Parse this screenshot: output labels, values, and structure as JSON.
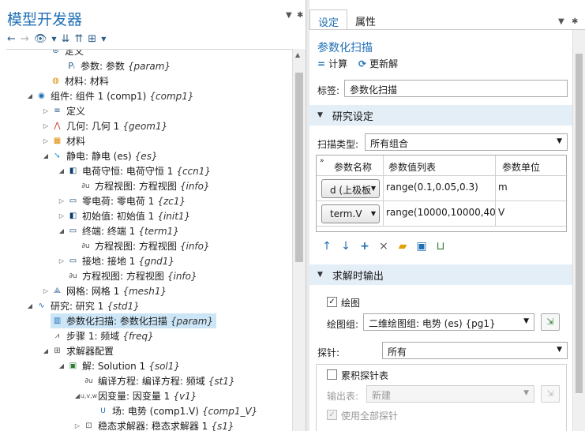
{
  "left_panel": {
    "title": "模型开发器",
    "tree": [
      {
        "label": "定义",
        "tag": ""
      },
      {
        "label": "参数: 参数",
        "tag": "{param}"
      },
      {
        "label": "材料: 材料",
        "tag": ""
      },
      {
        "label": "组件: 组件 1 (comp1)",
        "tag": "{comp1}"
      },
      {
        "label": "定义",
        "tag": ""
      },
      {
        "label": "几何: 几何 1",
        "tag": "{geom1}"
      },
      {
        "label": "材料",
        "tag": ""
      },
      {
        "label": "静电: 静电 (es)",
        "tag": "{es}"
      },
      {
        "label": "电荷守恒: 电荷守恒 1",
        "tag": "{ccn1}"
      },
      {
        "label": "方程视图: 方程视图",
        "tag": "{info}"
      },
      {
        "label": "零电荷: 零电荷 1",
        "tag": "{zc1}"
      },
      {
        "label": "初始值: 初始值 1",
        "tag": "{init1}"
      },
      {
        "label": "终端: 终端 1",
        "tag": "{term1}"
      },
      {
        "label": "方程视图: 方程视图",
        "tag": "{info}"
      },
      {
        "label": "接地: 接地 1",
        "tag": "{gnd1}"
      },
      {
        "label": "方程视图: 方程视图",
        "tag": "{info}"
      },
      {
        "label": "网格: 网格 1",
        "tag": "{mesh1}"
      },
      {
        "label": "研究: 研究 1",
        "tag": "{std1}"
      },
      {
        "label": "参数化扫描: 参数化扫描",
        "tag": "{param}"
      },
      {
        "label": "步骤 1: 频域",
        "tag": "{freq}"
      },
      {
        "label": "求解器配置",
        "tag": ""
      },
      {
        "label": "解: Solution 1",
        "tag": "{sol1}"
      },
      {
        "label": "编译方程: 编译方程: 频域",
        "tag": "{st1}"
      },
      {
        "label": "因变量: 因变量 1",
        "tag": "{v1}"
      },
      {
        "label": "场: 电势 (comp1.V)",
        "tag": "{comp1_V}"
      },
      {
        "label": "稳态求解器: 稳态求解器 1",
        "tag": "{s1}"
      }
    ]
  },
  "right_panel": {
    "tabs": [
      "设定",
      "属性"
    ],
    "title": "参数化扫描",
    "actions": {
      "compute": "计算",
      "update": "更新解"
    },
    "label_field": {
      "label": "标签:",
      "value": "参数化扫描"
    },
    "study_settings": {
      "header": "研究设定",
      "sweep_type_label": "扫描类型:",
      "sweep_type_value": "所有组合",
      "table": {
        "col1": "参数名称",
        "col2": "参数值列表",
        "col3": "参数单位",
        "rows": [
          {
            "name": "d (上极板",
            "values": "range(0.1,0.05,0.3)",
            "unit": "m"
          },
          {
            "name": "term.V",
            "values": "range(10000,10000,40...",
            "unit": "V"
          }
        ]
      }
    },
    "output": {
      "header": "求解时输出",
      "plot_label": "绘图",
      "plot_group_label": "绘图组:",
      "plot_group_value": "二维绘图组: 电势 (es) {pg1}",
      "probe_label": "探针:",
      "probe_value": "所有",
      "accumulate_label": "累积探针表",
      "output_table_label": "输出表:",
      "output_table_value": "新建",
      "use_all_probes_label": "使用全部探针"
    }
  }
}
